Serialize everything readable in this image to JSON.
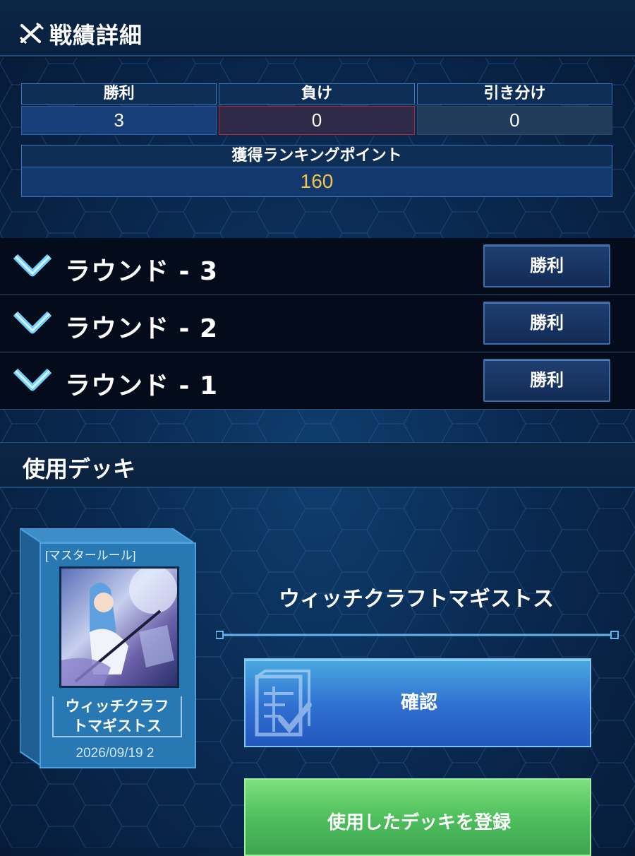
{
  "header": {
    "title": "戦績詳細",
    "icon": "crossed-swords-icon"
  },
  "stats": {
    "win_label": "勝利",
    "win_value": "3",
    "lose_label": "負け",
    "lose_value": "0",
    "draw_label": "引き分け",
    "draw_value": "0"
  },
  "ranking": {
    "label": "獲得ランキングポイント",
    "value": "160"
  },
  "rounds": [
    {
      "label": "ラウンド - 3",
      "result": "勝利"
    },
    {
      "label": "ラウンド - 2",
      "result": "勝利"
    },
    {
      "label": "ラウンド - 1",
      "result": "勝利"
    }
  ],
  "deck_section": {
    "title": "使用デッキ",
    "deckbox": {
      "rule": "[マスタールール]",
      "name_line1": "ウィッチクラフ",
      "name_line2": "トマギストス",
      "date": "2026/09/19 2"
    },
    "deck_name": "ウィッチクラフトマギストス",
    "confirm_button": "確認",
    "register_button": "使用したデッキを登録"
  },
  "colors": {
    "points_value": "#f3c443",
    "confirm_button": "#2f6fd0",
    "register_button": "#4fbf5d"
  }
}
